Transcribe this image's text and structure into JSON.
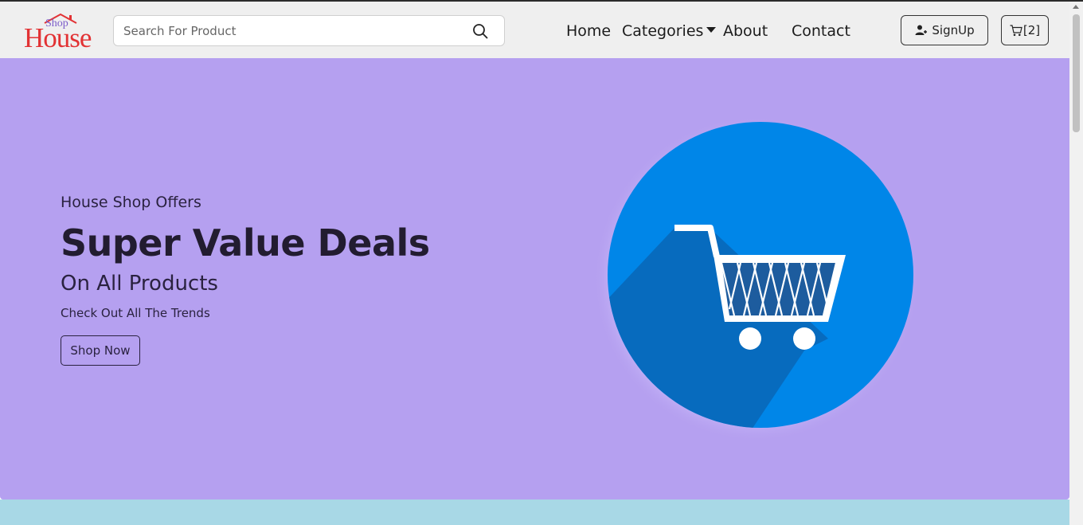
{
  "brand": {
    "logo_top": "Shop",
    "logo_main": "House"
  },
  "search": {
    "placeholder": "Search For Product",
    "value": ""
  },
  "nav": {
    "home": "Home",
    "categories": "Categories",
    "about": "About",
    "contact": "Contact"
  },
  "actions": {
    "signup": "SignUp",
    "cart": "[2]"
  },
  "hero": {
    "eyebrow": "House Shop Offers",
    "title": "Super Value Deals",
    "subtitle": "On All Products",
    "description": "Check Out All The Trends",
    "cta": "Shop Now"
  },
  "colors": {
    "navbar_bg": "#efefef",
    "hero_bg": "#b5a0f0",
    "next_section_bg": "#a8d8e6",
    "logo_red": "#e23234",
    "logo_purple": "#7a5bc9",
    "cart_circle": "#0086e8"
  },
  "icons": {
    "search": "search-icon",
    "user_add": "user-plus-icon",
    "cart": "cart-icon",
    "caret": "caret-down-icon",
    "hero": "shopping-cart-illustration"
  }
}
